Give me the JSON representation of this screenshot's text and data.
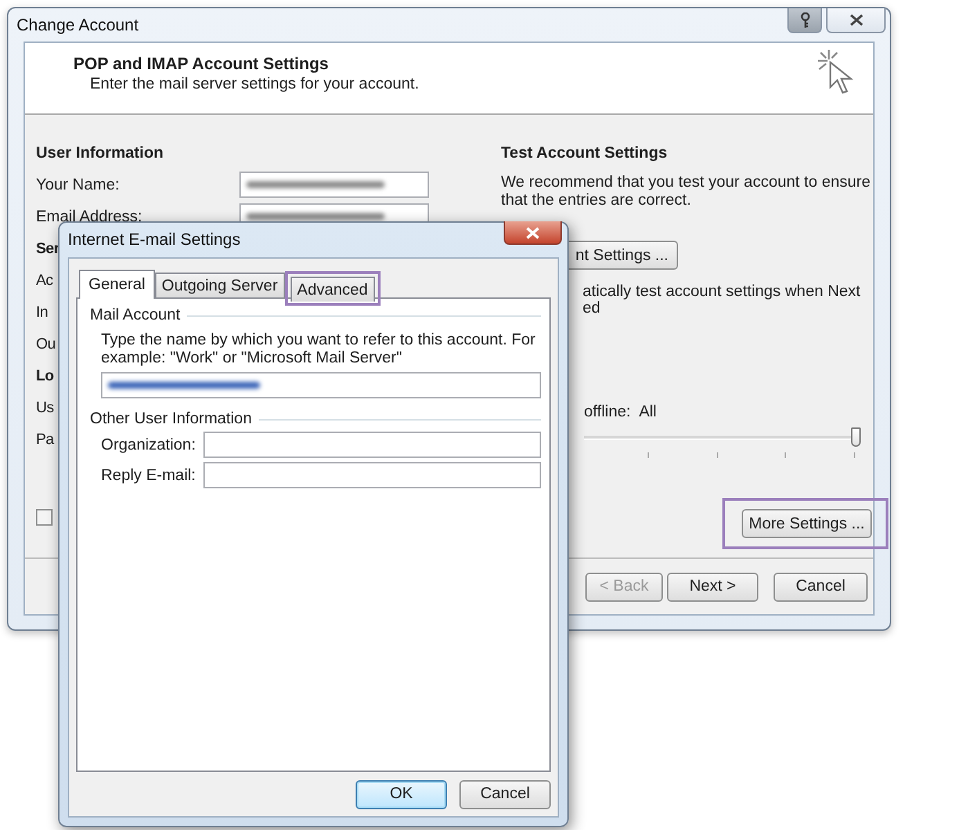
{
  "main_window": {
    "title": "Change Account",
    "header": {
      "title": "POP and IMAP Account Settings",
      "subtitle": "Enter the mail server settings for your account."
    },
    "left_items": [
      {
        "kind": "heading",
        "text": "User Information"
      },
      {
        "kind": "field",
        "text": "Your Name:"
      },
      {
        "kind": "field",
        "text": "Email Address:"
      },
      {
        "kind": "heading",
        "text": "Ser"
      },
      {
        "kind": "label",
        "text": "Ac"
      },
      {
        "kind": "label",
        "text": "In"
      },
      {
        "kind": "label",
        "text": "Ou"
      },
      {
        "kind": "heading",
        "text": "Lo"
      },
      {
        "kind": "label",
        "text": "Us"
      },
      {
        "kind": "label",
        "text": "Pa"
      }
    ],
    "checkbox": {
      "checked": false
    },
    "test": {
      "heading": "Test Account Settings",
      "description": "We recommend that you test your account to ensure that the entries are correct.",
      "button": "nt Settings ...",
      "auto_test_lines": [
        "atically test account settings when Next",
        "ed"
      ]
    },
    "offline": {
      "label": "offline:",
      "value": "All"
    },
    "slider": {
      "level": 1
    },
    "more_settings": {
      "label": "More Settings ...",
      "highlighted": true
    },
    "buttons": [
      {
        "label": "< Back",
        "disabled": true
      },
      {
        "label": "Next >",
        "disabled": false
      },
      {
        "label": "Cancel",
        "disabled": false
      }
    ]
  },
  "dialog": {
    "title": "Internet E-mail Settings",
    "tabs": [
      {
        "label": "General",
        "selected": true,
        "highlighted": false
      },
      {
        "label": "Outgoing Server",
        "selected": false,
        "highlighted": false
      },
      {
        "label": "Advanced",
        "selected": false,
        "highlighted": true
      }
    ],
    "mail_account": {
      "heading": "Mail Account",
      "description": "Type the name by which you want to refer to this account. For example: \"Work\" or \"Microsoft Mail Server\""
    },
    "other_info": {
      "heading": "Other User Information",
      "fields": [
        {
          "label": "Organization:"
        },
        {
          "label": "Reply E-mail:"
        }
      ]
    },
    "buttons": [
      {
        "label": "OK",
        "default": true
      },
      {
        "label": "Cancel",
        "default": false
      }
    ]
  }
}
